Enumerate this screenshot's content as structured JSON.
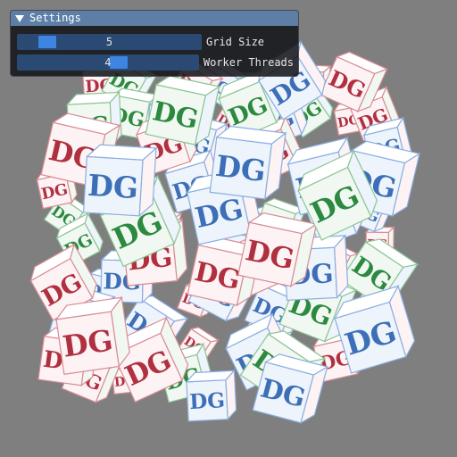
{
  "settings_window": {
    "title": "Settings",
    "collapse_icon": "triangle-down-icon",
    "sliders": [
      {
        "label": "Grid Size",
        "value": "5",
        "fraction": 0.12
      },
      {
        "label": "Worker Threads",
        "value": "4",
        "fraction": 0.56
      }
    ]
  },
  "scene": {
    "background_color": "#7f7f7f",
    "cube_text": "DG",
    "glyph_colors": [
      "#b03040",
      "#2c8a40",
      "#3d6fb8"
    ],
    "face_colors": [
      "#fdf3f4",
      "#f1f8f1",
      "#eef4fb",
      "#ffffff"
    ]
  }
}
